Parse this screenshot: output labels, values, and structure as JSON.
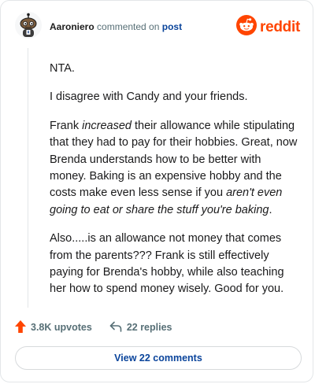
{
  "header": {
    "username": "Aaroniero",
    "action_text": "commented on",
    "post_link": "post",
    "brand": "reddit",
    "avatar_icon": "snoo-avatar-icon",
    "brand_icon": "reddit-snoo-logo-icon",
    "brand_color": "#ff4500"
  },
  "comment": {
    "p1": "NTA.",
    "p2": "I disagree with Candy and your friends.",
    "p3_a": "Frank ",
    "p3_em": "increased",
    "p3_b": " their allowance while stipulating that they had to pay for their hobbies. Great, now Brenda understands how to be better with money. Baking is an expensive hobby and the costs make even less sense if you ",
    "p3_em2": "aren't even going to eat or share the stuff you're baking",
    "p3_c": ".",
    "p4": "Also.....is an allowance not money that comes from the parents??? Frank is still effectively paying for Brenda's hobby, while also teaching her how to spend money wisely. Good for you."
  },
  "footer": {
    "upvotes": "3.8K upvotes",
    "replies": "22 replies",
    "upvote_icon": "upvote-arrow-icon",
    "reply_icon": "reply-arrow-icon",
    "upvote_color": "#ff4500"
  },
  "view_button": {
    "label": "View 22 comments"
  }
}
